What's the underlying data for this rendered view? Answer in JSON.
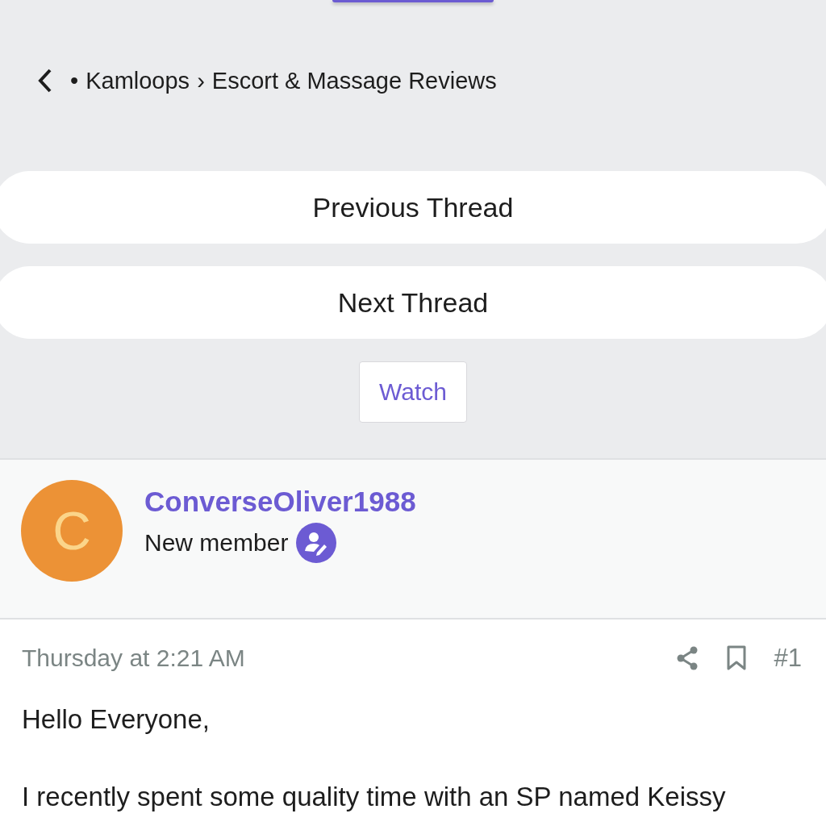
{
  "breadcrumb": {
    "prefix": "•",
    "separator": "›",
    "items": [
      "Kamloops",
      "Escort & Massage Reviews"
    ]
  },
  "thread_nav": [
    "Previous Thread",
    "Next Thread"
  ],
  "watch_button": "Watch",
  "author": {
    "initial": "C",
    "name": "ConverseOliver1988",
    "title": "New member"
  },
  "post": {
    "time": "Thursday at 2:21 AM",
    "number": "#1",
    "paragraphs": [
      "Hello Everyone,",
      "I recently spent some quality time with an SP named Keissy"
    ]
  }
}
